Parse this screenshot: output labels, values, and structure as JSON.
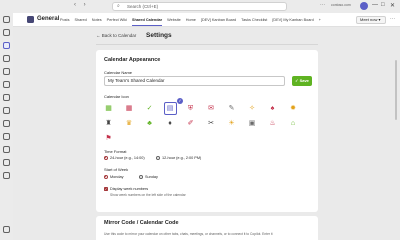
{
  "titlebar": {
    "search_placeholder": "Search (Ctrl+E)",
    "org": "contoso.com",
    "nav_arrows": "‹ ›",
    "window_controls": [
      "—",
      "□",
      "✕"
    ]
  },
  "channel": {
    "team_name": "General",
    "tabs": [
      "Posts",
      "Shared",
      "Notes",
      "Perfect Wiki",
      "Shared Calendar",
      "Website",
      "Home",
      "[DEV] Kanban Board",
      "Tasks Checklist",
      "[DEV] My Kanban Board",
      "+"
    ],
    "active_tab_index": 4,
    "meet_label": "Meet now"
  },
  "settings": {
    "back_label": "Back to Calendar",
    "page_title": "Settings",
    "appearance": {
      "section_title": "Calendar Appearance",
      "name_label": "Calendar Name",
      "name_value": "My Team's Shared Calendar",
      "save_label": "Save",
      "icon_label": "Calendar Icon",
      "icons": [
        {
          "name": "green-calendar-icon",
          "glyph": "▦",
          "color": "#5fb322"
        },
        {
          "name": "red-calendar-icon",
          "glyph": "▦",
          "color": "#c4314b"
        },
        {
          "name": "green-check-calendar-icon",
          "glyph": "✓",
          "color": "#5fb322"
        },
        {
          "name": "blue-calendar-icon",
          "glyph": "▤",
          "color": "#5b5fc7"
        },
        {
          "name": "shield-icon",
          "glyph": "⛨",
          "color": "#c4314b"
        },
        {
          "name": "gift-icon",
          "glyph": "✉",
          "color": "#c4314b"
        },
        {
          "name": "pencil-icon",
          "glyph": "✎",
          "color": "#6b6b6b"
        },
        {
          "name": "lightbulb-icon",
          "glyph": "✧",
          "color": "#e3a21a"
        },
        {
          "name": "balloon-icon",
          "glyph": "♠",
          "color": "#c4314b"
        },
        {
          "name": "fire-icon",
          "glyph": "✹",
          "color": "#e3a21a"
        },
        {
          "name": "dumbbell-icon",
          "glyph": "♜",
          "color": "#444444"
        },
        {
          "name": "trophy-icon",
          "glyph": "♛",
          "color": "#e3a21a"
        },
        {
          "name": "palm-tree-icon",
          "glyph": "♣",
          "color": "#5fb322"
        },
        {
          "name": "graduation-cap-icon",
          "glyph": "♦",
          "color": "#444444"
        },
        {
          "name": "pen-icon",
          "glyph": "✐",
          "color": "#c4314b"
        },
        {
          "name": "briefcase-icon",
          "glyph": "✂",
          "color": "#444444"
        },
        {
          "name": "sun-icon",
          "glyph": "☀",
          "color": "#e3a21a"
        },
        {
          "name": "picture-icon",
          "glyph": "▣",
          "color": "#6b6b6b"
        },
        {
          "name": "cake-icon",
          "glyph": "♨",
          "color": "#c4314b"
        },
        {
          "name": "house-icon",
          "glyph": "⌂",
          "color": "#5fb322"
        },
        {
          "name": "flag-icon",
          "glyph": "⚑",
          "color": "#c4314b"
        }
      ],
      "selected_icon_index": 3,
      "time_format_label": "Time Format",
      "time_options": [
        "24-hour (e.g., 14:00)",
        "12-hour (e.g., 2:00 PM)"
      ],
      "time_selected": 0,
      "week_start_label": "Start of Week",
      "week_options": [
        "Monday",
        "Sunday"
      ],
      "week_selected": 0,
      "week_numbers_label": "Display week numbers",
      "week_numbers_hint": "Show week numbers on the left side of the calendar",
      "week_numbers_checked": true
    },
    "mirror": {
      "section_title": "Mirror Code / Calendar Code",
      "description": "Use this code to mirror your calendar on other tabs, chats, meetings, or channels, or to connect it to Copilot. Enter it"
    }
  },
  "colors": {
    "accent": "#5b5fc7",
    "save": "#5fb322",
    "radio": "#a4373a"
  }
}
